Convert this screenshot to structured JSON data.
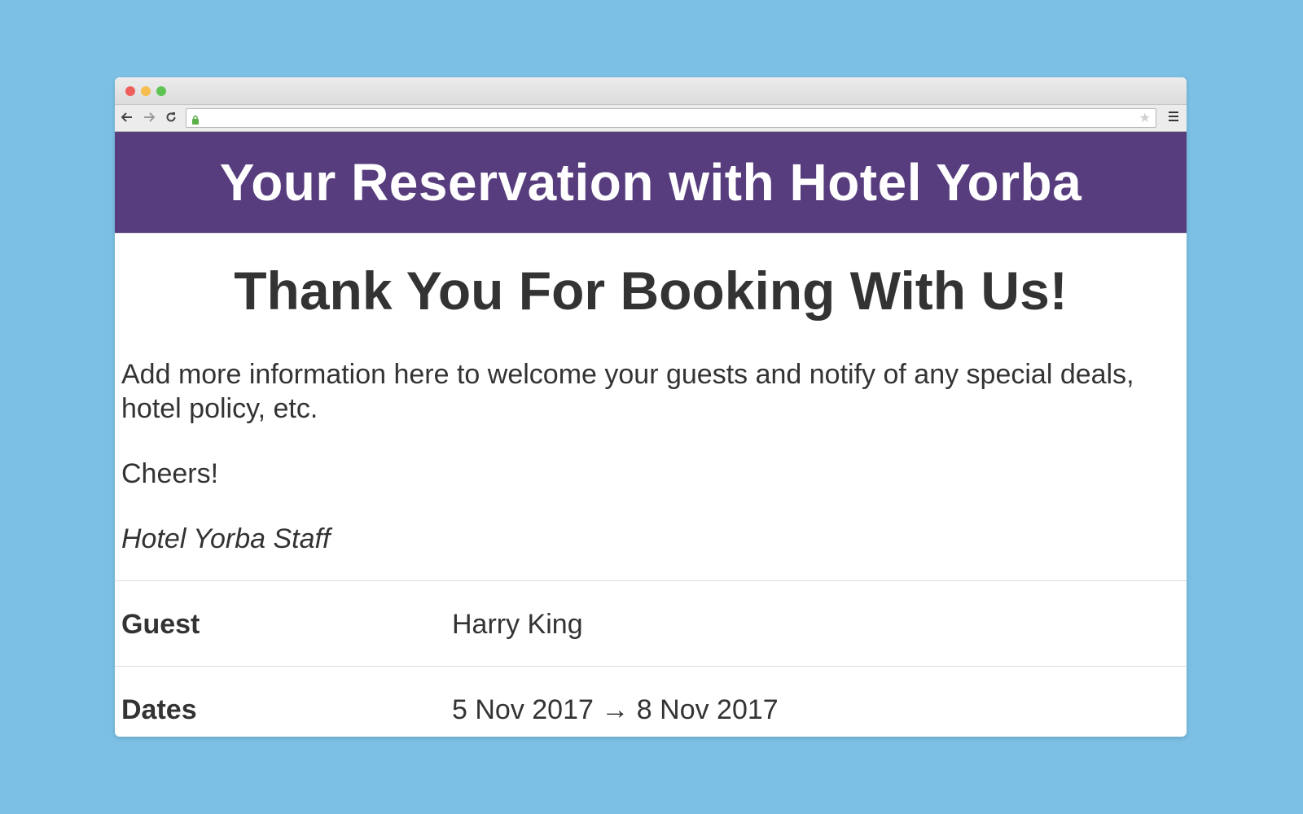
{
  "window": {
    "traffic_lights": [
      {
        "name": "close",
        "color": "#ee5f5b"
      },
      {
        "name": "minimize",
        "color": "#f6be4f"
      },
      {
        "name": "zoom",
        "color": "#5fc454"
      }
    ],
    "toolbar": {
      "back_icon": "arrow-left-icon",
      "forward_icon": "arrow-right-icon",
      "reload_icon": "reload-icon",
      "lock_icon": "lock-icon",
      "bookmark_icon": "star-icon",
      "menu_icon": "hamburger-menu-icon",
      "url": ""
    }
  },
  "colors": {
    "banner": "#573d7e",
    "background": "#7cc0e5",
    "text": "#333333"
  },
  "banner": {
    "title": "Your Reservation with Hotel Yorba"
  },
  "main": {
    "heading": "Thank You For Booking With Us!",
    "message": "Add more information here to welcome your guests and notify of any special deals, hotel policy, etc.",
    "signoff": "Cheers!",
    "signature": "Hotel Yorba Staff"
  },
  "details": [
    {
      "label": "Guest",
      "value": "Harry King"
    },
    {
      "label": "Dates",
      "value": "5 Nov 2017 → 8 Nov 2017"
    }
  ]
}
